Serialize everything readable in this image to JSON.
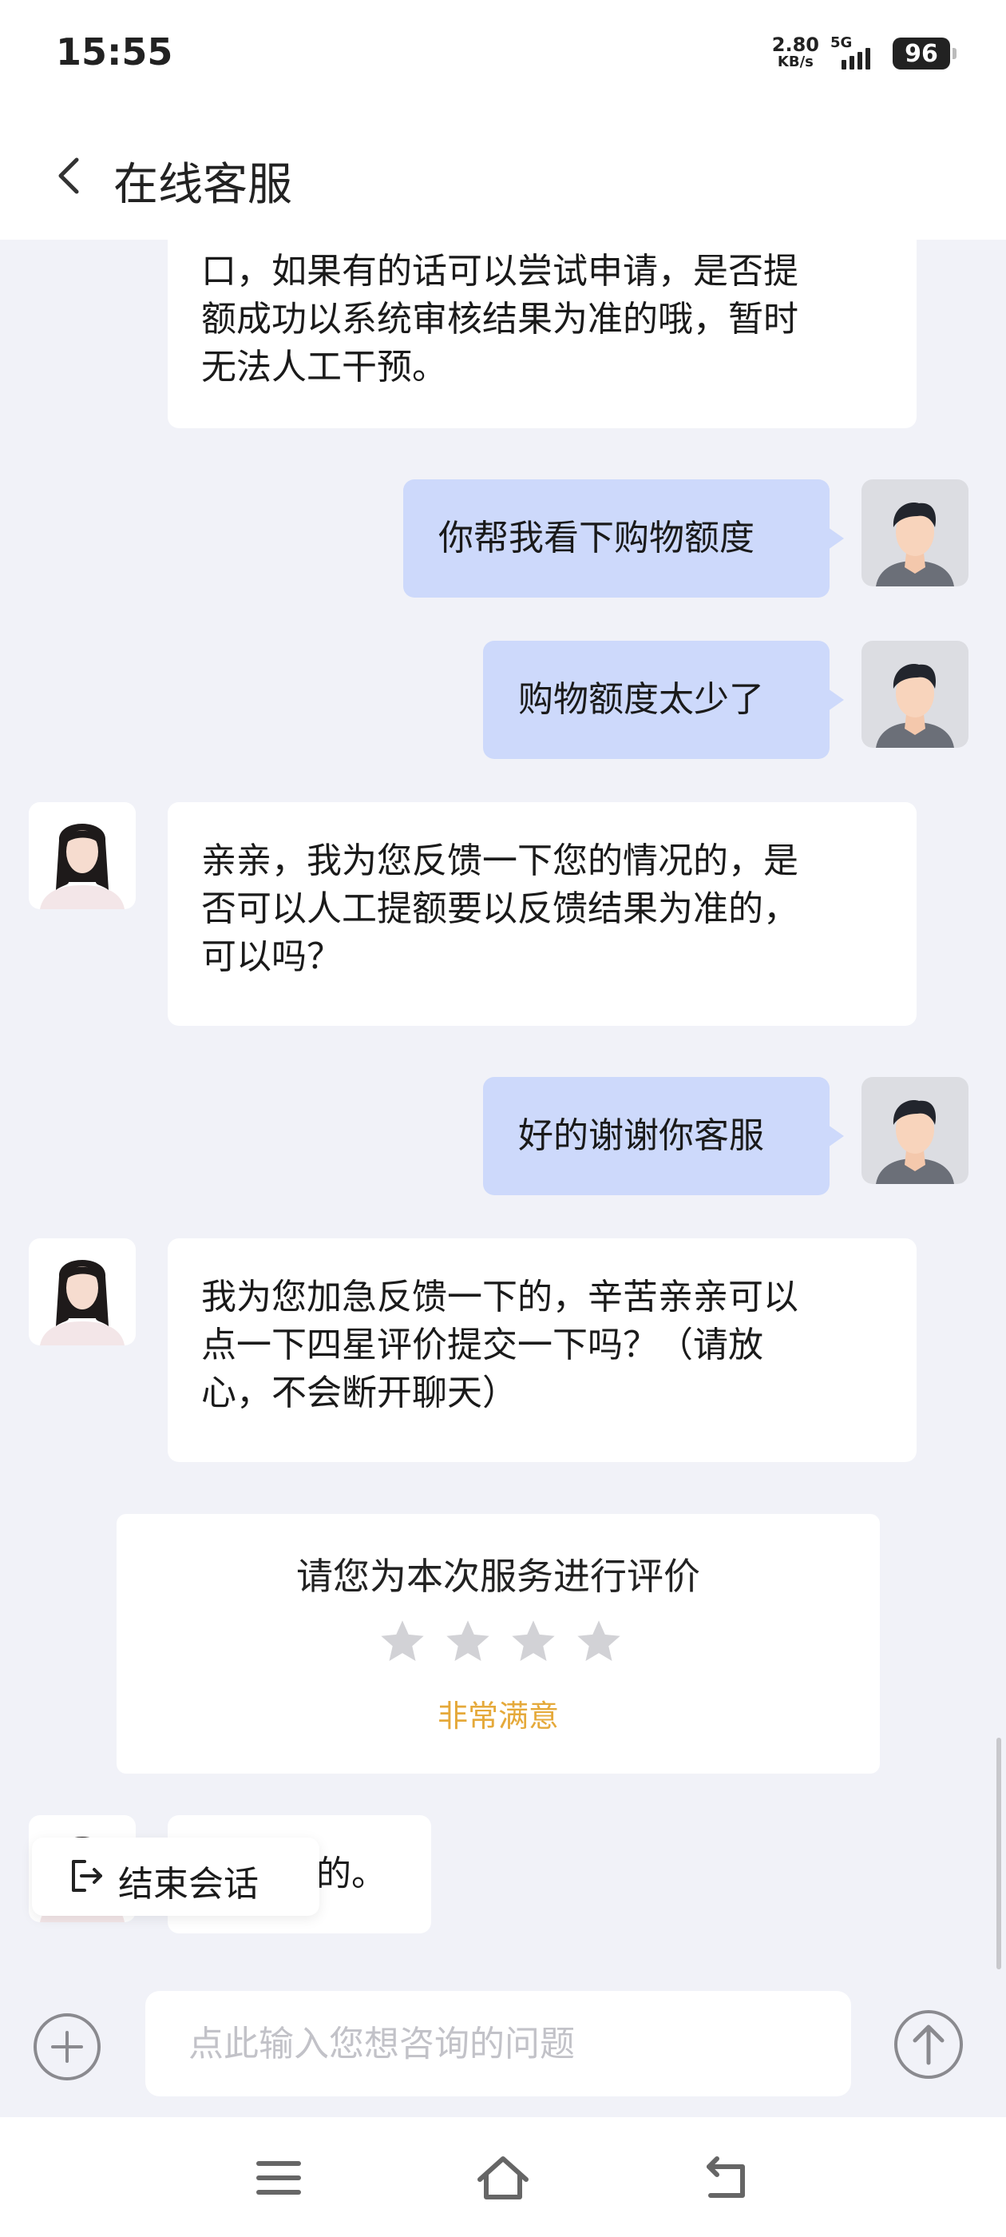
{
  "status_bar": {
    "time": "15:55",
    "net_speed_value": "2.80",
    "net_speed_unit": "KB/s",
    "network": "5G",
    "battery": "96"
  },
  "header": {
    "title": "在线客服",
    "back_icon": "chevron-left-icon"
  },
  "messages": [
    {
      "side": "agent",
      "lines": [
        "口，如果有的话可以尝试申请，是否提",
        "额成功以系统审核结果为准的哦，暂时",
        "无法人工干预。"
      ]
    },
    {
      "side": "user",
      "text": "你帮我看下购物额度"
    },
    {
      "side": "user",
      "text": "购物额度太少了"
    },
    {
      "side": "agent",
      "lines": [
        "亲亲，我为您反馈一下您的情况的，是",
        "否可以人工提额要以反馈结果为准的，",
        "可以吗？"
      ]
    },
    {
      "side": "user",
      "text": "好的谢谢你客服"
    },
    {
      "side": "agent",
      "lines": [
        "我为您加急反馈一下的，辛苦亲亲可以",
        "点一下四星评价提交一下吗？（请放",
        "心，不会断开聊天）"
      ]
    },
    {
      "side": "agent",
      "text": "的。"
    }
  ],
  "rating": {
    "title": "请您为本次服务进行评价",
    "stars_total": 4,
    "stars_selected": 0,
    "label": "非常满意",
    "label_color": "#e5a93a"
  },
  "end_session": {
    "label": "结束会话",
    "icon": "exit-icon"
  },
  "input": {
    "placeholder": "点此输入您想咨询的问题",
    "value": ""
  },
  "colors": {
    "background": "#f1f2f8",
    "user_bubble": "#cdd9fb",
    "agent_bubble": "#ffffff"
  },
  "nav": {
    "icons": [
      "menu-icon",
      "home-icon",
      "back-icon"
    ]
  }
}
